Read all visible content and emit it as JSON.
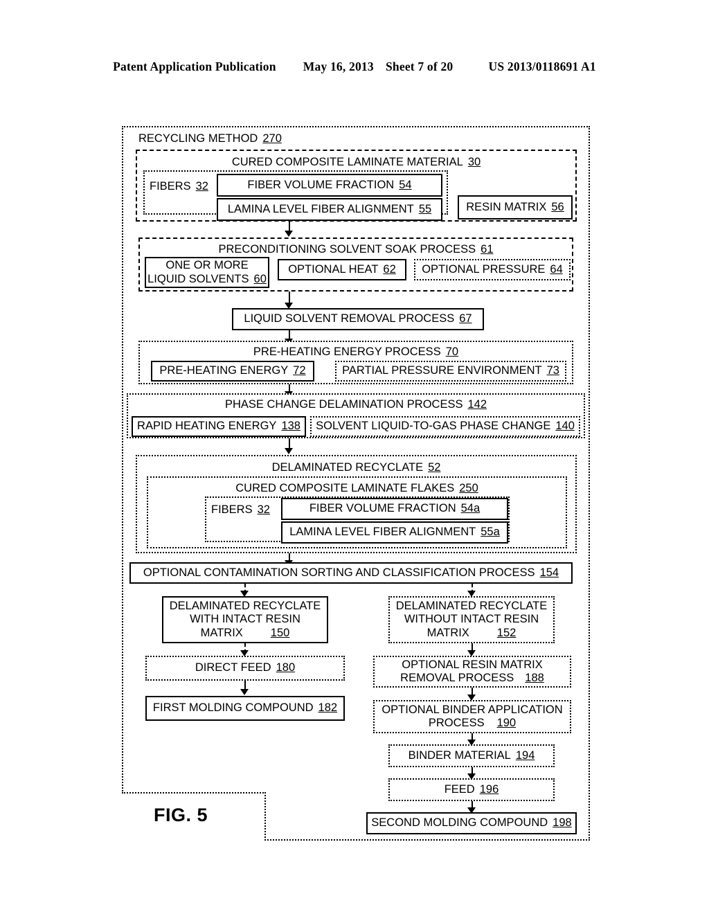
{
  "header": {
    "publication": "Patent Application Publication",
    "date": "May 16, 2013",
    "sheet": "Sheet 7 of 20",
    "doc_number": "US 2013/0118691 A1"
  },
  "figure": {
    "label": "FIG. 5"
  },
  "diagram": {
    "title": "RECYCLING METHOD",
    "title_ref": "270",
    "nodes": {
      "cured_composite": {
        "text": "CURED COMPOSITE LAMINATE MATERIAL",
        "ref": "30"
      },
      "fibers": {
        "text": "FIBERS",
        "ref": "32"
      },
      "fiber_volume_fraction": {
        "text": "FIBER VOLUME FRACTION",
        "ref": "54"
      },
      "lamina_alignment": {
        "text": "LAMINA LEVEL FIBER ALIGNMENT",
        "ref": "55"
      },
      "resin_matrix": {
        "text": "RESIN MATRIX",
        "ref": "56"
      },
      "precond_soak": {
        "text": "PRECONDITIONING SOLVENT SOAK PROCESS",
        "ref": "61"
      },
      "liquid_solvents_l1": {
        "text": "ONE OR MORE",
        "ref": ""
      },
      "liquid_solvents_l2": {
        "text": "LIQUID SOLVENTS",
        "ref": "60"
      },
      "optional_heat": {
        "text": "OPTIONAL HEAT",
        "ref": "62"
      },
      "optional_pressure": {
        "text": "OPTIONAL PRESSURE",
        "ref": "64"
      },
      "solvent_removal": {
        "text": "LIQUID SOLVENT REMOVAL PROCESS",
        "ref": "67"
      },
      "preheat_process": {
        "text": "PRE-HEATING ENERGY PROCESS",
        "ref": "70"
      },
      "preheat_energy": {
        "text": "PRE-HEATING ENERGY",
        "ref": "72"
      },
      "partial_pressure": {
        "text": "PARTIAL PRESSURE ENVIRONMENT",
        "ref": "73"
      },
      "phase_change_process": {
        "text": "PHASE CHANGE DELAMINATION PROCESS",
        "ref": "142"
      },
      "rapid_heating": {
        "text": "RAPID HEATING ENERGY",
        "ref": "138"
      },
      "liquid_to_gas": {
        "text": "SOLVENT LIQUID-TO-GAS PHASE CHANGE",
        "ref": "140"
      },
      "delaminated_recyclate": {
        "text": "DELAMINATED RECYCLATE",
        "ref": "52"
      },
      "laminate_flakes": {
        "text": "CURED COMPOSITE LAMINATE FLAKES",
        "ref": "250"
      },
      "fibers_b": {
        "text": "FIBERS",
        "ref": "32"
      },
      "fiber_volume_fraction_a": {
        "text": "FIBER VOLUME FRACTION",
        "ref": "54a"
      },
      "lamina_alignment_a": {
        "text": "LAMINA LEVEL FIBER ALIGNMENT",
        "ref": "55a"
      },
      "sorting_process": {
        "text": "OPTIONAL CONTAMINATION SORTING AND CLASSIFICATION PROCESS",
        "ref": "154"
      },
      "with_intact_l1": {
        "text": "DELAMINATED RECYCLATE",
        "ref": ""
      },
      "with_intact_l2": {
        "text": "WITH INTACT RESIN",
        "ref": ""
      },
      "with_intact_l3": {
        "text": "MATRIX",
        "ref": "150"
      },
      "without_intact_l1": {
        "text": "DELAMINATED RECYCLATE",
        "ref": ""
      },
      "without_intact_l2": {
        "text": "WITHOUT INTACT RESIN",
        "ref": ""
      },
      "without_intact_l3": {
        "text": "MATRIX",
        "ref": "152"
      },
      "direct_feed": {
        "text": "DIRECT FEED",
        "ref": "180"
      },
      "first_molding": {
        "text": "FIRST MOLDING COMPOUND",
        "ref": "182"
      },
      "resin_removal_l1": {
        "text": "OPTIONAL RESIN MATRIX",
        "ref": ""
      },
      "resin_removal_l2": {
        "text": "REMOVAL PROCESS",
        "ref": "188"
      },
      "binder_app_l1": {
        "text": "OPTIONAL BINDER APPLICATION",
        "ref": ""
      },
      "binder_app_l2": {
        "text": "PROCESS",
        "ref": "190"
      },
      "binder_material": {
        "text": "BINDER MATERIAL",
        "ref": "194"
      },
      "feed": {
        "text": "FEED",
        "ref": "196"
      },
      "second_molding": {
        "text": "SECOND MOLDING COMPOUND",
        "ref": "198"
      }
    }
  }
}
